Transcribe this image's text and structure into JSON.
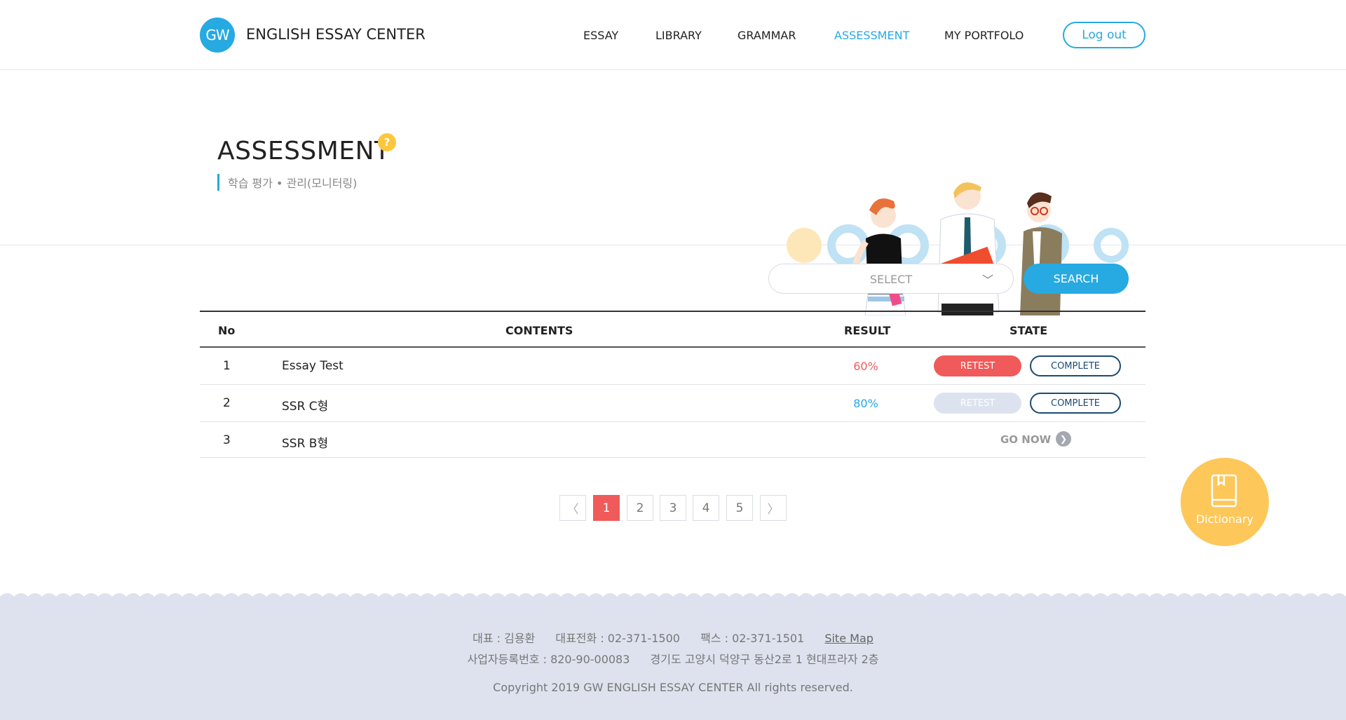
{
  "header": {
    "logo_text": "GW",
    "brand": "ENGLISH ESSAY CENTER",
    "nav": [
      "ESSAY",
      "LIBRARY",
      "GRAMMAR",
      "ASSESSMENT",
      "MY PORTFOLO"
    ],
    "active_nav": "ASSESSMENT",
    "logout_label": "Log out"
  },
  "hero": {
    "title": "ASSESSMENT",
    "help_icon": "?",
    "subtitle": "학습 평가 • 관리(모니터링)"
  },
  "search": {
    "select_placeholder": "SELECT",
    "button_label": "SEARCH"
  },
  "table": {
    "headers": [
      "No",
      "CONTENTS",
      "RESULT",
      "STATE"
    ],
    "rows": [
      {
        "no": "1",
        "content": "Essay Test",
        "result": "60%",
        "result_color": "#f05a5a",
        "retest": "RETEST",
        "complete": "COMPLETE"
      },
      {
        "no": "2",
        "content": "SSR C형",
        "result": "80%",
        "result_color": "#27a9e1",
        "retest": "RETEST",
        "complete": "COMPLETE"
      },
      {
        "no": "3",
        "content": "SSR B형",
        "go_now": "GO NOW"
      }
    ]
  },
  "pagination": {
    "prev": "〈",
    "pages": [
      "1",
      "2",
      "3",
      "4",
      "5"
    ],
    "current": "1",
    "next": "〉"
  },
  "dictionary": {
    "label": "Dictionary"
  },
  "footer": {
    "ceo": "대표 : 김용환",
    "phone": "대표전화 : 02-371-1500",
    "fax": "팩스 : 02-371-1501",
    "sitemap": "Site Map",
    "biz_no": "사업자등록번호 : 820-90-00083",
    "address": "경기도 고양시 덕양구 동산2로 1 현대프라자 2층",
    "copyright": "Copyright 2019 GW ENGLISH ESSAY CENTER All rights reserved."
  },
  "colors": {
    "accent": "#27a9e1",
    "retest": "#f05a5a",
    "complete": "#1c4a70",
    "dictionary": "#fdc75a",
    "footer_bg": "#dde2ee"
  }
}
